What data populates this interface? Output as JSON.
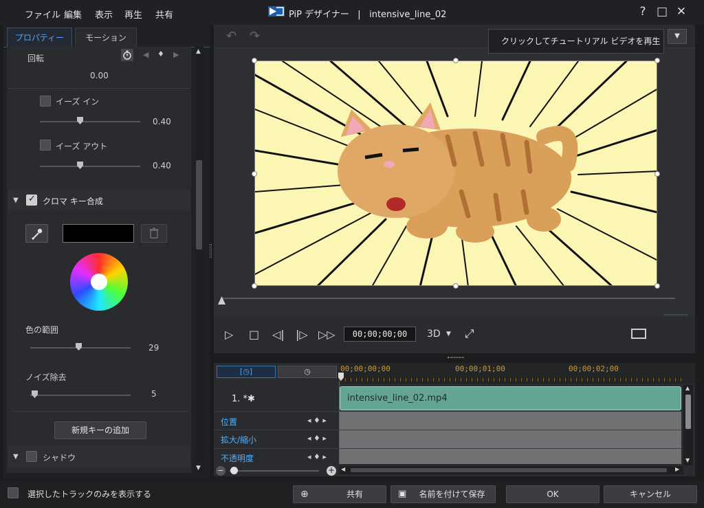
{
  "menu": [
    "ファイル",
    "編集",
    "表示",
    "再生",
    "共有"
  ],
  "title": {
    "app": "PiP デザイナー",
    "separator": "|",
    "file": "intensive_line_02"
  },
  "window_buttons": {
    "help": "?",
    "maximize": "□",
    "close": "✕"
  },
  "tabs": {
    "properties": "プロパティー",
    "motion": "モーション"
  },
  "rotation": {
    "label": "回転",
    "value": "0.00"
  },
  "ease_in": {
    "label": "イーズ イン",
    "value": "0.40"
  },
  "ease_out": {
    "label": "イーズ アウト",
    "value": "0.40"
  },
  "chroma": {
    "label": "クロマ キー合成",
    "color_range_label": "色の範囲",
    "color_range_value": "29",
    "noise_label": "ノイズ除去",
    "noise_value": "5",
    "add_key_button": "新規キーの追加"
  },
  "shadow": {
    "label": "シャドウ"
  },
  "tooltip": "クリックしてチュートリアル ビデオを再生",
  "playback": {
    "timecode": "00;00;00;00",
    "mode_3d": "3D"
  },
  "timeline": {
    "ruler": [
      "00;00;00;00",
      "00;00;01;00",
      "00;00;02;00"
    ],
    "track_label": "1. *✱",
    "clip_name": "intensive_line_02.mp4",
    "rows": [
      "位置",
      "拡大/縮小",
      "不透明度"
    ]
  },
  "footer": {
    "show_selected_label": "選択したトラックのみを表示する",
    "share_button": "共有",
    "save_as_button": "名前を付けて保存",
    "ok_button": "OK",
    "cancel_button": "キャンセル"
  },
  "colors": {
    "accent": "#4aa6ff",
    "clip": "#64a494",
    "ruler_text": "#c99a3b",
    "canvas_bg": "#fbf6b4"
  }
}
